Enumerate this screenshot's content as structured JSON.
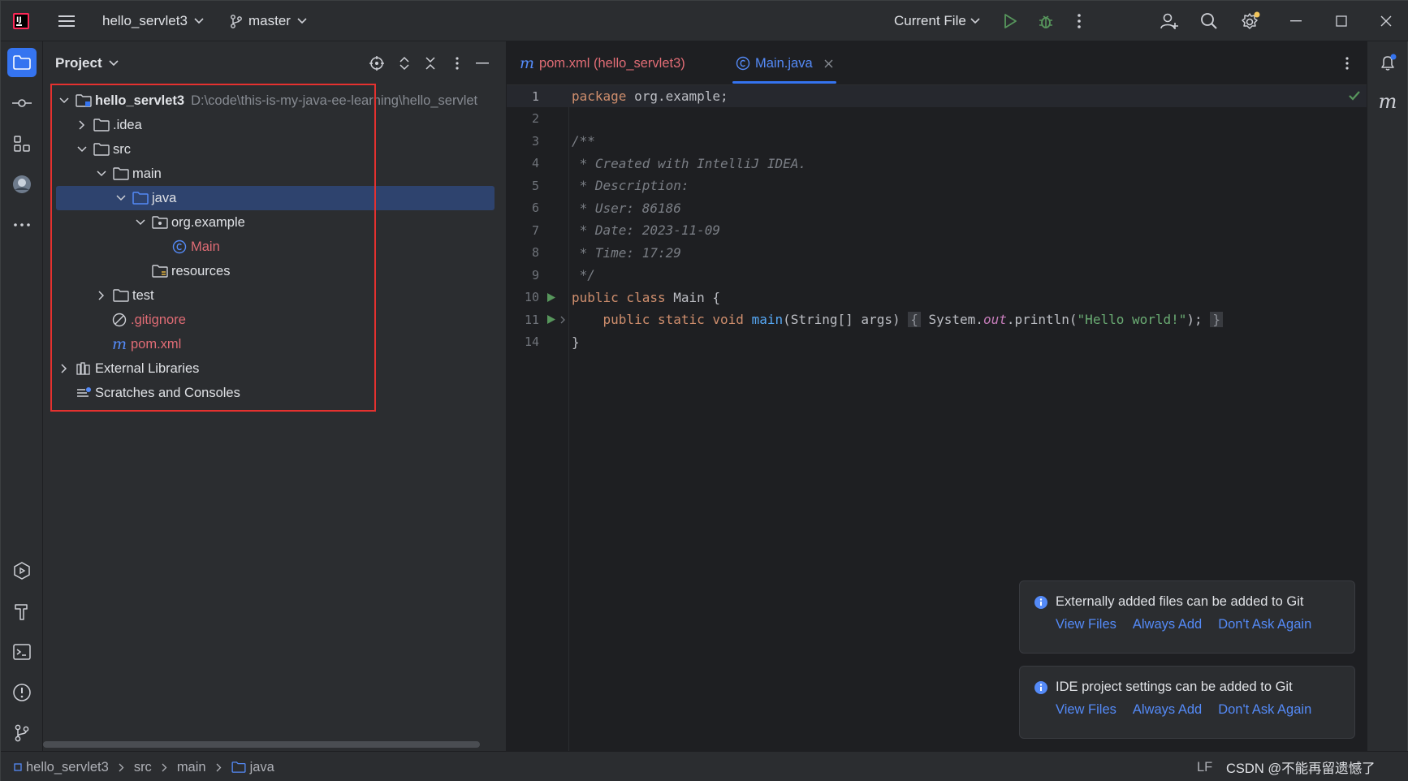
{
  "titlebar": {
    "project_name": "hello_servlet3",
    "branch": "master",
    "run_config": "Current File"
  },
  "project_panel": {
    "title": "Project",
    "tree": {
      "root_name": "hello_servlet3",
      "root_path": "D:\\code\\this-is-my-java-ee-learning\\hello_servlet",
      "idea": ".idea",
      "src": "src",
      "main": "main",
      "java": "java",
      "package": "org.example",
      "main_class": "Main",
      "resources": "resources",
      "test": "test",
      "gitignore": ".gitignore",
      "pom": "pom.xml",
      "external_libraries": "External Libraries",
      "scratches": "Scratches and Consoles"
    }
  },
  "editor": {
    "tabs": {
      "pom": "pom.xml (hello_servlet3)",
      "main": "Main.java"
    },
    "lines": [
      {
        "num": "1"
      },
      {
        "num": "2"
      },
      {
        "num": "3",
        "text": "/**"
      },
      {
        "num": "4",
        "text": " * Created with IntelliJ IDEA."
      },
      {
        "num": "5",
        "text": " * Description:"
      },
      {
        "num": "6",
        "text": " * User: 86186"
      },
      {
        "num": "7",
        "text": " * Date: 2023-11-09"
      },
      {
        "num": "8",
        "text": " * Time: 17:29"
      },
      {
        "num": "9",
        "text": " */"
      },
      {
        "num": "10"
      },
      {
        "num": "11"
      },
      {
        "num": "14",
        "text": "}"
      }
    ],
    "code": {
      "l1_kw": "package",
      "l1_rest": " org.example;",
      "l10_kw": "public class",
      "l10_rest": " Main {",
      "l11_kw": "public static void",
      "l11_fn": "main",
      "l11_args": "(String[] args)",
      "l11_open": "{",
      "l11_obj": " System.",
      "l11_out": "out",
      "l11_call": ".println(",
      "l11_str": "\"Hello world!\"",
      "l11_end": ");",
      "l11_close": "}"
    }
  },
  "notifications": [
    {
      "title": "Externally added files can be added to Git",
      "actions": [
        "View Files",
        "Always Add",
        "Don't Ask Again"
      ]
    },
    {
      "title": "IDE project settings can be added to Git",
      "actions": [
        "View Files",
        "Always Add",
        "Don't Ask Again"
      ]
    }
  ],
  "statusbar": {
    "breadcrumb": [
      "hello_servlet3",
      "src",
      "main",
      "java"
    ],
    "line_sep": "LF",
    "watermark": "CSDN @不能再留遗憾了"
  },
  "colors": {
    "accent": "#3574f0",
    "highlight_box": "#e5312f",
    "selection": "#2e436e"
  }
}
